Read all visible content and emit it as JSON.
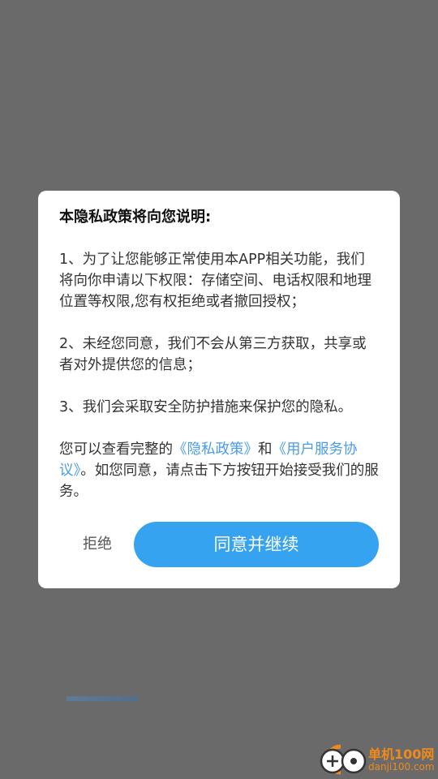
{
  "dialog": {
    "title": "本隐私政策将向您说明:",
    "item1": "1、为了让您能够正常使用本APP相关功能，我们将向你申请以下权限：存储空间、电话权限和地理位置等权限,您有权拒绝或者撤回授权；",
    "item2": "2、未经您同意，我们不会从第三方获取，共享或者对外提供您的信息；",
    "item3": "3、我们会采取安全防护措施来保护您的隐私。",
    "consent": {
      "prefix": "您可以查看完整的",
      "privacy_link": "《隐私政策》",
      "and": "和",
      "agreement_link": "《用户服务协议》",
      "suffix": "。如您同意，请点击下方按钮开始接受我们的服务。"
    },
    "decline_label": "拒绝",
    "agree_label": "同意并继续"
  },
  "watermark": {
    "name": "单机100网",
    "domain": "danji100.com"
  },
  "colors": {
    "overlay": "#6a6a6a",
    "primary_button": "#36a3f0",
    "link": "#4a9be8",
    "watermark": "#f08a1c"
  }
}
